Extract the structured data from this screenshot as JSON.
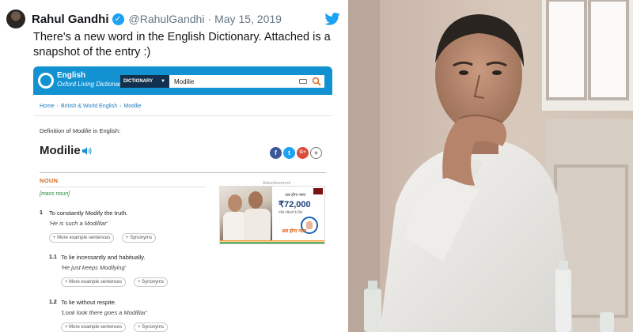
{
  "tweet": {
    "author_name": "Rahul Gandhi",
    "handle": "@RahulGandhi",
    "separator": "·",
    "date": "May 15, 2019",
    "text": "There's a new word in the English Dictionary. Attached is a snapshot of the entry :)",
    "verified_glyph": "✓",
    "icons": [
      "avatar",
      "verified-badge-icon",
      "twitter-bird-icon"
    ]
  },
  "dictionary": {
    "logo_title": "English",
    "logo_subtitle": "Oxford Living Dictionaries",
    "search": {
      "category": "DICTIONARY",
      "category_arrow": "▼",
      "value": "Modilie"
    },
    "breadcrumb": [
      "Home",
      "British & World English",
      "Modilie"
    ],
    "breadcrumb_sep": "›",
    "definition_prefix": "Definition of ",
    "definition_word": "Modilie",
    "definition_suffix": " in English:",
    "headword": "Modilie",
    "share": {
      "facebook": "f",
      "twitter": "t",
      "google": "G+",
      "more": "+"
    },
    "part_of_speech": "NOUN",
    "grammar_note": "[mass noun]",
    "senses": [
      {
        "num": "1",
        "def": "To constantly Modify the truth.",
        "example": "'He is such a Modilliar'"
      },
      {
        "num": "1.1",
        "def": "To lie incessantly and habitually.",
        "example": "'He just keeps Modilying'"
      },
      {
        "num": "1.2",
        "def": "To lie without respite.",
        "example": "'Look look there goes a Modilliar'"
      }
    ],
    "more_examples_label": "+ More example sentences",
    "synonyms_label": "+ Synonyms",
    "ad": {
      "label": "Advertisement",
      "hindi_top": "अब होगा न्याय",
      "amount": "₹72,000",
      "hindi_sub": "गरीब परिवारों के लिए",
      "hindi_brand": "अब होगा न्याय"
    }
  },
  "colors": {
    "twitter_blue": "#1da1f2",
    "oxford_blue": "#1392d2",
    "search_category_bg": "#13314e",
    "pos_orange": "#d2691e",
    "grammar_green": "#2a8a3a",
    "facebook": "#3b5998",
    "twitter_share": "#1da1f2",
    "google_plus": "#dd4b39"
  }
}
